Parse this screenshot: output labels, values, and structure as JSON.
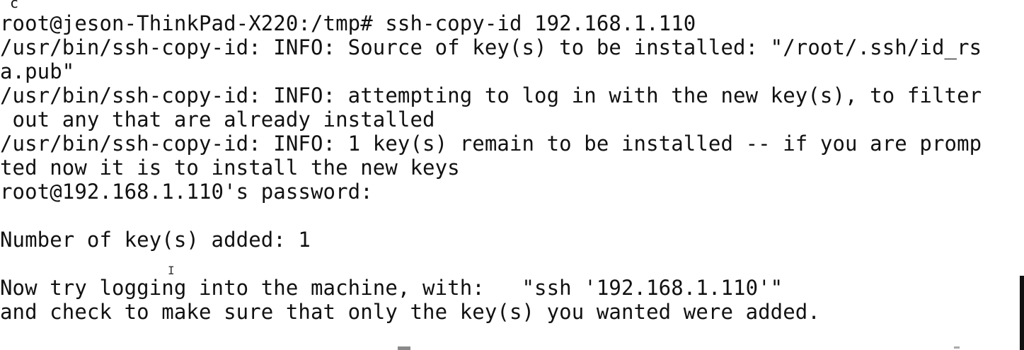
{
  "terminal": {
    "top_fragment": "c",
    "lines": [
      "root@jeson-ThinkPad-X220:/tmp# ssh-copy-id 192.168.1.110",
      "/usr/bin/ssh-copy-id: INFO: Source of key(s) to be installed: \"/root/.ssh/id_rs",
      "a.pub\"",
      "/usr/bin/ssh-copy-id: INFO: attempting to log in with the new key(s), to filter",
      " out any that are already installed",
      "/usr/bin/ssh-copy-id: INFO: 1 key(s) remain to be installed -- if you are promp",
      "ted now it is to install the new keys",
      "root@192.168.1.110's password:",
      "",
      "Number of key(s) added: 1",
      "",
      "Now try logging into the machine, with:   \"ssh '192.168.1.110'\"",
      "and check to make sure that only the key(s) you wanted were added."
    ]
  }
}
